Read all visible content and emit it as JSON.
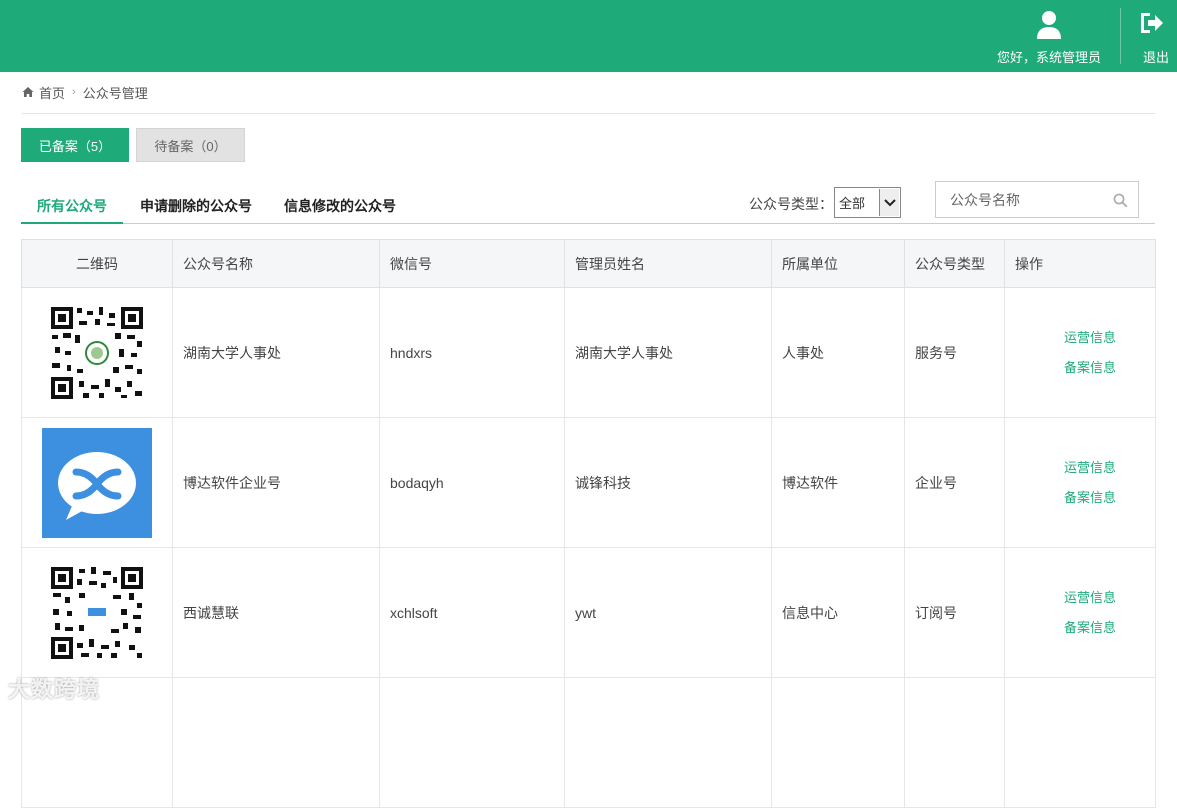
{
  "header": {
    "greeting": "您好，系统管理员",
    "logout_label": "退出",
    "accent_color": "#1faa7a"
  },
  "breadcrumb": {
    "home": "首页",
    "current": "公众号管理"
  },
  "status_tabs": {
    "filed": "已备案（5）",
    "pending": "待备案（0）"
  },
  "sub_tabs": {
    "all": "所有公众号",
    "delete_requests": "申请删除的公众号",
    "modify_requests": "信息修改的公众号"
  },
  "filter": {
    "type_label": "公众号类型：",
    "type_selected": "全部",
    "search_placeholder": "公众号名称"
  },
  "table": {
    "headers": [
      "二维码",
      "公众号名称",
      "微信号",
      "管理员姓名",
      "所属单位",
      "公众号类型",
      "操作"
    ],
    "rows": [
      {
        "image": "qr-code",
        "name": "湖南大学人事处",
        "wechat_id": "hndxrs",
        "admin": "湖南大学人事处",
        "unit": "人事处",
        "type": "服务号",
        "op1": "运营信息",
        "op2": "备案信息"
      },
      {
        "image": "app-logo",
        "name": "博达软件企业号",
        "wechat_id": "bodaqyh",
        "admin": "诚锋科技",
        "unit": "博达软件",
        "type": "企业号",
        "op1": "运营信息",
        "op2": "备案信息"
      },
      {
        "image": "qr-code",
        "name": "西诚慧联",
        "wechat_id": "xchlsoft",
        "admin": "ywt",
        "unit": "信息中心",
        "type": "订阅号",
        "op1": "运营信息",
        "op2": "备案信息"
      }
    ]
  },
  "watermark": "大数跨境"
}
